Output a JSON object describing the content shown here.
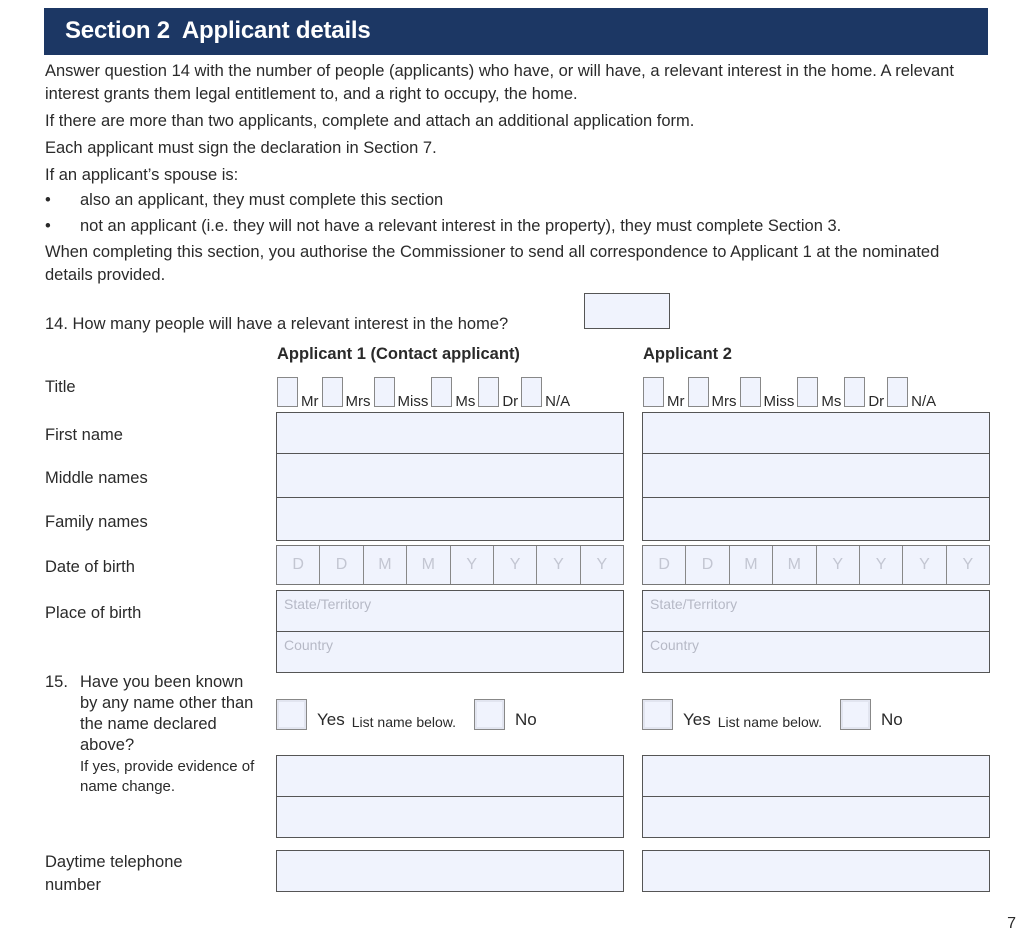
{
  "header": {
    "section": "Section 2",
    "title": "Applicant details"
  },
  "intro": {
    "p1": "Answer question 14 with the number of people (applicants) who have, or will have, a relevant interest in the home. A relevant interest grants them legal entitlement to, and a right to occupy, the home.",
    "p2": "If there are more than two applicants, complete and attach an additional application form.",
    "p3": "Each applicant must sign the declaration in Section 7.",
    "p4": "If an applicant’s spouse is:",
    "bullets": [
      "also an applicant, they must complete this section",
      "not an applicant (i.e. they will not have a relevant interest in the property), they must complete Section 3."
    ],
    "p5": "When completing this section, you authorise the Commissioner to send all correspondence to Applicant 1 at the nominated details provided.",
    "bullet_glyph": "•"
  },
  "q14": {
    "label": "14. How many people will have a relevant interest in the home?",
    "value": ""
  },
  "columns": {
    "applicant1": "Applicant 1 (Contact applicant)",
    "applicant2": "Applicant 2"
  },
  "rows": {
    "title": "Title",
    "first_name": "First name",
    "middle_names": "Middle names",
    "family_names": "Family names",
    "dob": "Date of birth",
    "pob": "Place of birth",
    "phone": "Daytime telephone number"
  },
  "title_options": [
    "Mr",
    "Mrs",
    "Miss",
    "Ms",
    "Dr",
    "N/A"
  ],
  "dob_placeholders": [
    "D",
    "D",
    "M",
    "M",
    "Y",
    "Y",
    "Y",
    "Y"
  ],
  "pob_placeholders": {
    "state": "State/Territory",
    "country": "Country"
  },
  "q15": {
    "label": "15. Have you been known by any name other than the name declared above?",
    "num": "15.",
    "text": "Have you been known by any name other than the name declared above?",
    "note": "If yes, provide evidence of name change.",
    "yes": "Yes",
    "hint": "List name below.",
    "no": "No"
  },
  "page_number": "7"
}
